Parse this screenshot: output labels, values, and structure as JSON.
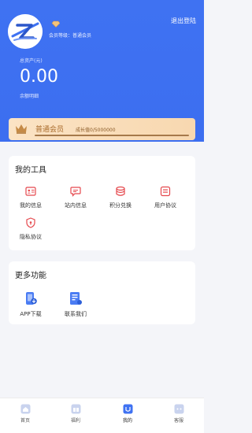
{
  "header": {
    "member_level_text": "会员等级：普通会员",
    "logout_label": "退出登陆",
    "assets_label": "总资产(元)",
    "assets_value": "0.00",
    "balance_detail_label": "余额明细"
  },
  "membership": {
    "name": "普通会员",
    "growth_text": "成长值0/5000000",
    "growth_fraction": 0
  },
  "tools": {
    "title": "我的工具",
    "items": [
      {
        "label": "我的信息",
        "icon": "id-card-icon"
      },
      {
        "label": "站内信息",
        "icon": "message-icon"
      },
      {
        "label": "积分兑换",
        "icon": "coin-stack-icon"
      },
      {
        "label": "用户协议",
        "icon": "agreement-icon"
      },
      {
        "label": "隐私协议",
        "icon": "privacy-shield-icon"
      }
    ]
  },
  "more": {
    "title": "更多功能",
    "items": [
      {
        "label": "APP下载",
        "icon": "app-download-icon"
      },
      {
        "label": "联系我们",
        "icon": "contact-icon"
      }
    ]
  },
  "tabbar": {
    "items": [
      {
        "label": "首页",
        "icon": "home-icon"
      },
      {
        "label": "福利",
        "icon": "gift-icon"
      },
      {
        "label": "我的",
        "icon": "profile-icon"
      },
      {
        "label": "客服",
        "icon": "customer-service-icon"
      }
    ],
    "active_index": 2
  },
  "colors": {
    "primary": "#3f72f2",
    "gold_dark": "#a86a2a",
    "icon_red": "#e5484d",
    "tab_inactive": "#aab6d6"
  }
}
